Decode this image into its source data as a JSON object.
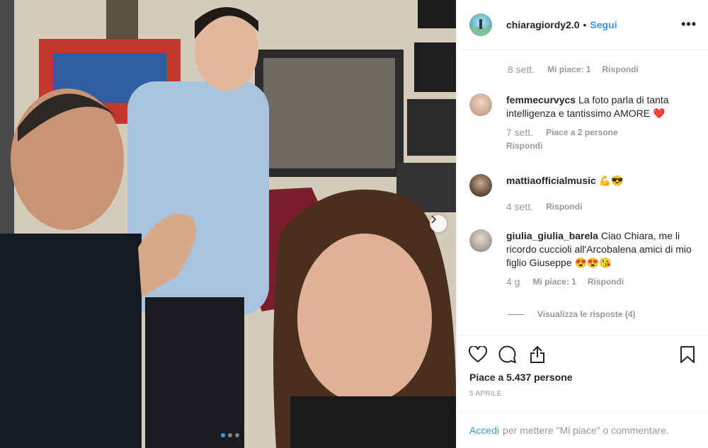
{
  "post": {
    "owner": "chiaragiordy2.0",
    "separator": "•",
    "follow_label": "Segui",
    "more_label": "•••",
    "like_count": "Piace a 5.437 persone",
    "date": "5 APRILE",
    "carousel_total": 3,
    "carousel_active": 1
  },
  "first_meta": {
    "time": "8 sett.",
    "likes": "Mi piace: 1",
    "reply": "Rispondi"
  },
  "comments": [
    {
      "user": "femmecurvycs",
      "text": "La foto parla di tanta intelligenza e tantissimo AMORE ❤️",
      "time": "7 sett.",
      "likes": "Piace a 2 persone",
      "reply": "Rispondi"
    },
    {
      "user": "mattiaofficialmusic",
      "text": "💪😎",
      "time": "4 sett.",
      "likes": "",
      "reply": "Rispondi"
    },
    {
      "user": "giulia_giulia_barela",
      "text": "Ciao Chiara, me li ricordo cuccioli all'Arcobalena amici di mio figlio Giuseppe 😍😍😘",
      "time": "4 g",
      "likes": "Mi piace: 1",
      "reply": "Rispondi"
    }
  ],
  "view_replies": "Visualizza le risposte (4)",
  "login": {
    "link": "Accedi",
    "rest": "per mettere \"Mi piace\" o commentare."
  },
  "icons": {
    "like": "heart-icon",
    "comment": "comment-icon",
    "share": "share-icon",
    "save": "bookmark-icon",
    "next": "chevron-right-icon"
  },
  "colors": {
    "accent": "#3897f0",
    "text": "#262626",
    "muted": "#999999",
    "border": "#efefef"
  }
}
